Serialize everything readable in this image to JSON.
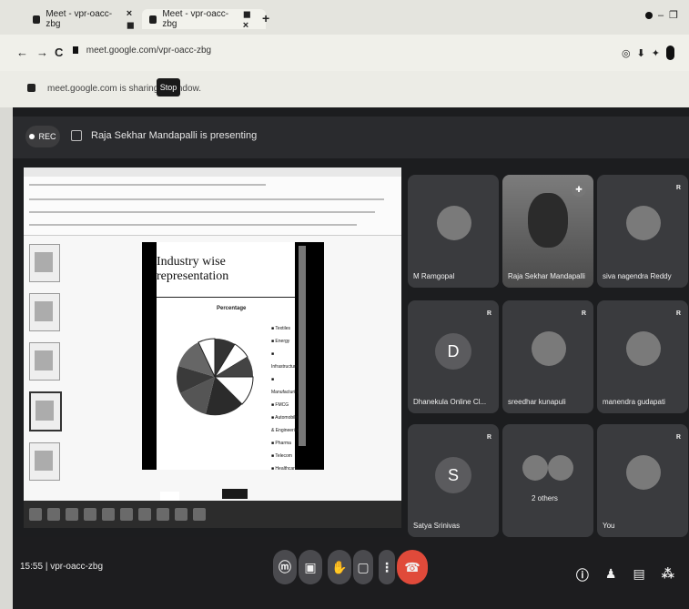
{
  "browser": {
    "tabs": [
      {
        "title": "Meet - vpr-oacc-zbg"
      },
      {
        "title": "Meet - vpr-oacc-zbg"
      }
    ],
    "url": "meet.google.com/vpr-oacc-zbg",
    "share_text": "meet.google.com is sharing a window.",
    "stop_label": "Stop"
  },
  "meet": {
    "rec_label": "REC",
    "presenting_text": "Raja Sekhar Mandapalli is presenting",
    "meeting_code": "vpr-oacc-zbg",
    "time": "15:55",
    "slide": {
      "heading": "Industry wise representation",
      "subheading": "Percentage",
      "legend": [
        "Textiles",
        "Energy",
        "Infrastructure",
        "Manufacturing",
        "FMCG",
        "Automobile & Engineering",
        "Pharma",
        "Telecom",
        "Healthcare"
      ]
    },
    "participants": [
      {
        "name": "M Ramgopal",
        "kind": "avatar"
      },
      {
        "name": "Raja Sekhar Mandapalli",
        "kind": "video"
      },
      {
        "name": "siva nagendra Reddy",
        "kind": "avatar"
      },
      {
        "name": "Dhanekula Online Cl...",
        "kind": "letter",
        "letter": "D"
      },
      {
        "name": "sreedhar kunapuli",
        "kind": "avatar"
      },
      {
        "name": "manendra gudapati",
        "kind": "avatar"
      },
      {
        "name": "Satya Srinivas",
        "kind": "letter",
        "letter": "S"
      },
      {
        "name": "2 others",
        "kind": "avatar"
      },
      {
        "name": "You",
        "kind": "avatar"
      }
    ]
  },
  "colors": {
    "meet_bg": "#1c1d1f",
    "tile_bg": "#3a3b3e",
    "end_call": "#e04a3a"
  },
  "icons": [
    "back-icon",
    "forward-icon",
    "reload-icon",
    "lock-icon",
    "mic-icon",
    "camera-icon",
    "hand-icon",
    "present-icon",
    "more-icon",
    "end-call-icon",
    "info-icon",
    "people-icon",
    "chat-icon",
    "activities-icon"
  ]
}
